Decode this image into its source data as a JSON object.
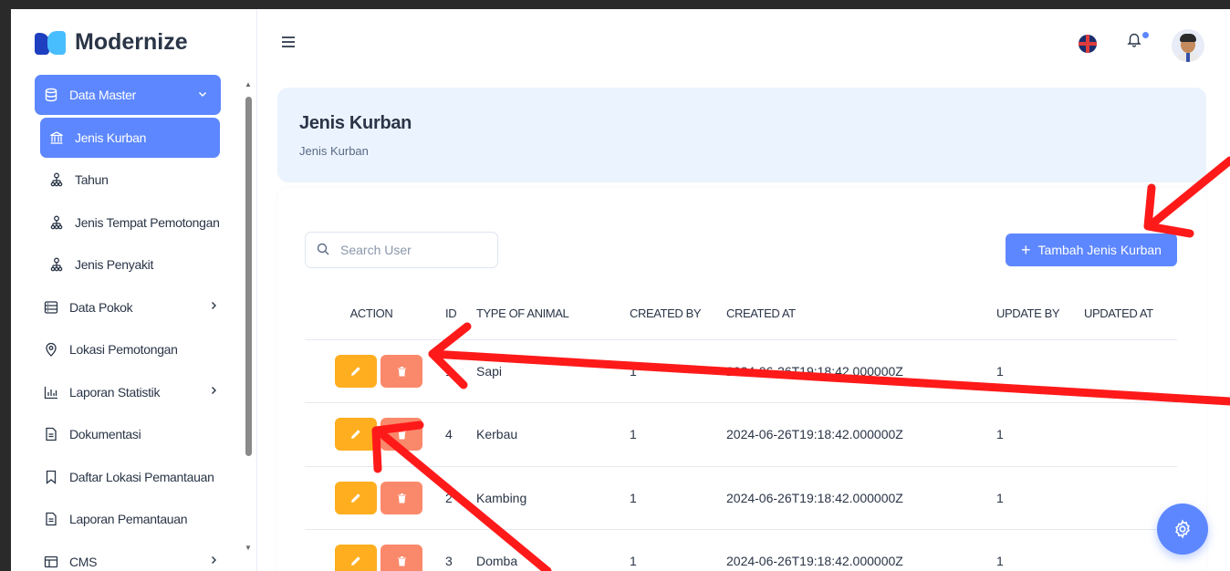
{
  "app": {
    "name": "Modernize"
  },
  "sidebar": {
    "items": [
      {
        "label": "Data Master",
        "icon": "database-icon",
        "state": "expanded-active"
      },
      {
        "label": "Jenis Kurban",
        "icon": "bank-icon",
        "state": "active-child"
      },
      {
        "label": "Tahun",
        "icon": "sitemap-icon",
        "state": "child"
      },
      {
        "label": "Jenis Tempat Pemotongan",
        "icon": "sitemap-icon",
        "state": "child"
      },
      {
        "label": "Jenis Penyakit",
        "icon": "sitemap-icon",
        "state": "child"
      },
      {
        "label": "Data Pokok",
        "icon": "server-icon",
        "state": "collapsed"
      },
      {
        "label": "Lokasi Pemotongan",
        "icon": "map-pin-icon",
        "state": "normal"
      },
      {
        "label": "Laporan Statistik",
        "icon": "chart-icon",
        "state": "collapsed"
      },
      {
        "label": "Dokumentasi",
        "icon": "file-icon",
        "state": "normal"
      },
      {
        "label": "Daftar Lokasi Pemantauan",
        "icon": "bookmark-icon",
        "state": "normal"
      },
      {
        "label": "Laporan Pemantauan",
        "icon": "file-icon",
        "state": "normal"
      },
      {
        "label": "CMS",
        "icon": "layout-icon",
        "state": "collapsed"
      }
    ]
  },
  "header": {
    "title": "Jenis Kurban",
    "breadcrumb": "Jenis Kurban"
  },
  "toolbar": {
    "search_placeholder": "Search User",
    "add_label": "Tambah Jenis Kurban"
  },
  "table": {
    "columns": [
      "ACTION",
      "ID",
      "TYPE OF ANIMAL",
      "CREATED BY",
      "CREATED AT",
      "UPDATE BY",
      "UPDATED AT"
    ],
    "rows": [
      {
        "id": "1",
        "type": "Sapi",
        "created_by": "1",
        "created_at": "2024-06-26T19:18:42.000000Z",
        "update_by": "1",
        "updated_at": ""
      },
      {
        "id": "4",
        "type": "Kerbau",
        "created_by": "1",
        "created_at": "2024-06-26T19:18:42.000000Z",
        "update_by": "1",
        "updated_at": ""
      },
      {
        "id": "2",
        "type": "Kambing",
        "created_by": "1",
        "created_at": "2024-06-26T19:18:42.000000Z",
        "update_by": "1",
        "updated_at": ""
      },
      {
        "id": "3",
        "type": "Domba",
        "created_by": "1",
        "created_at": "2024-06-26T19:18:42.000000Z",
        "update_by": "1",
        "updated_at": ""
      }
    ]
  },
  "colors": {
    "primary": "#5d87ff",
    "edit": "#ffae1f",
    "delete": "#fa896b",
    "header_bg": "#ebf3fe",
    "annotation": "#ff1a1a"
  }
}
